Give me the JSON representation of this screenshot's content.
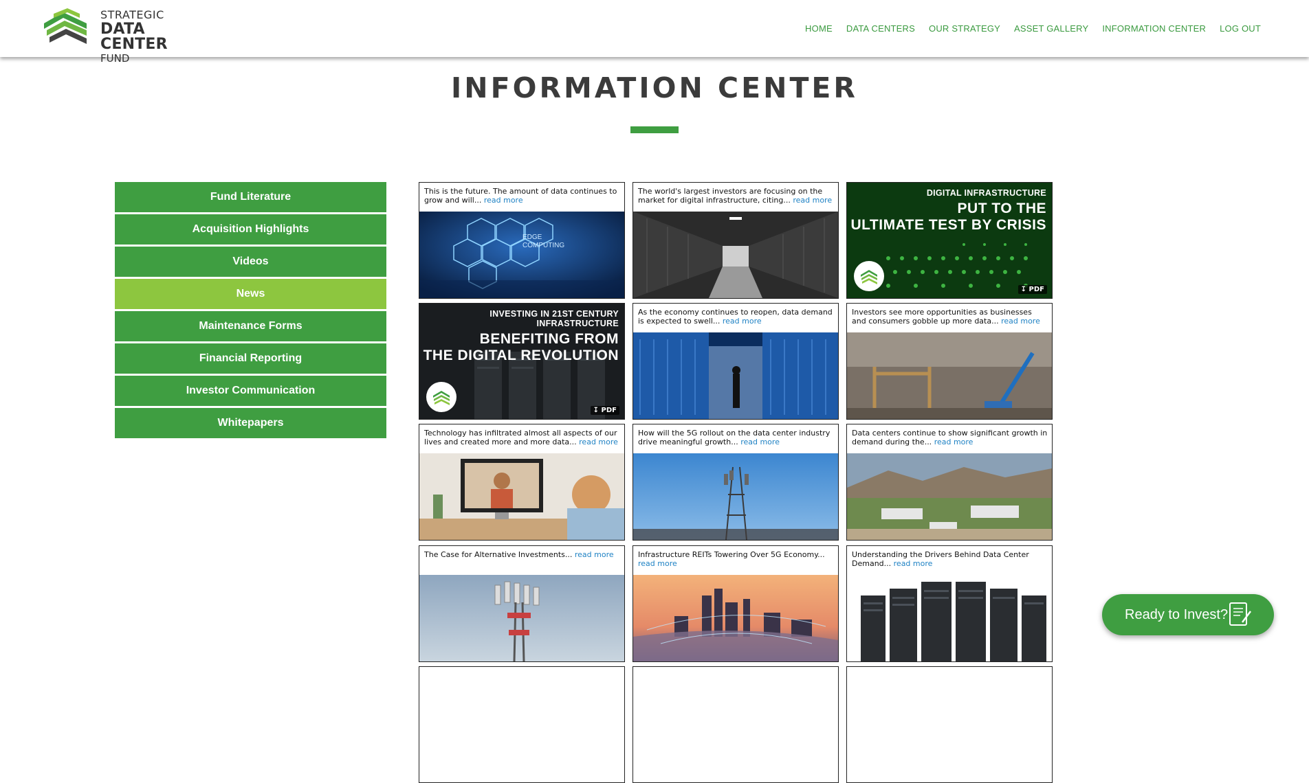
{
  "brand": {
    "line1": "STRATEGIC",
    "line2": "DATA CENTER",
    "line3": "FUND"
  },
  "nav": [
    "HOME",
    "DATA CENTERS",
    "OUR STRATEGY",
    "ASSET GALLERY",
    "INFORMATION CENTER",
    "LOG OUT"
  ],
  "page_title": "INFORMATION CENTER",
  "sidebar": {
    "items": [
      {
        "label": "Fund Literature"
      },
      {
        "label": "Acquisition Highlights"
      },
      {
        "label": "Videos"
      },
      {
        "label": "News",
        "active": true
      },
      {
        "label": "Maintenance Forms"
      },
      {
        "label": "Financial Reporting"
      },
      {
        "label": "Investor Communication"
      },
      {
        "label": "Whitepapers"
      }
    ]
  },
  "cards": {
    "read_more": "read more",
    "pdf_label": "PDF",
    "c1": "This is the future. The amount of data continues to grow and will...",
    "c2": "The world's largest investors are focusing on the market for digital infrastructure, citing...",
    "c3_small": "DIGITAL INFRASTRUCTURE",
    "c3_big1": "PUT TO THE",
    "c3_big2": "ULTIMATE TEST BY CRISIS",
    "c4_small": "INVESTING IN 21ST CENTURY INFRASTRUCTURE",
    "c4_big1": "BENEFITING FROM",
    "c4_big2": "THE DIGITAL REVOLUTION",
    "c5": "As the economy continues to reopen, data demand is expected to swell...",
    "c6": "Investors see more opportunities as businesses and consumers gobble up more data...",
    "c7": "Technology has infiltrated almost all aspects of our lives and created more and more data...",
    "c8": "How will the 5G rollout on the data center industry drive meaningful growth...",
    "c9": "Data centers continue to show significant growth in demand during the...",
    "c10": "The Case for Alternative Investments...",
    "c11": "Infrastructure REITs Towering Over 5G Economy...",
    "c12": "Understanding the Drivers Behind Data Center Demand...",
    "edge_text1": "EDGE",
    "edge_text2": "COMPUTING"
  },
  "cta": {
    "label": "Ready to Invest?"
  },
  "colors": {
    "green": "#3f9e41",
    "active_green": "#8dc63f",
    "link_blue": "#1f82c4",
    "title_gray": "#3b3b3b"
  }
}
